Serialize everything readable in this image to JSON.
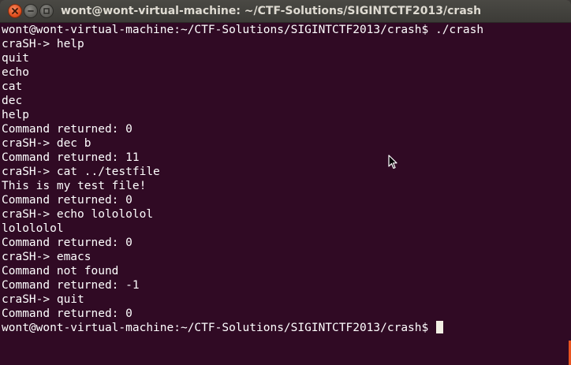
{
  "window": {
    "title": "wont@wont-virtual-machine: ~/CTF-Solutions/SIGINTCTF2013/crash",
    "buttons": {
      "close_icon": "close-icon",
      "minimize_icon": "minimize-icon",
      "maximize_icon": "maximize-icon"
    }
  },
  "terminal": {
    "lines": [
      "wont@wont-virtual-machine:~/CTF-Solutions/SIGINTCTF2013/crash$ ./crash",
      "craSH-> help",
      "quit",
      "echo",
      "cat",
      "dec",
      "help",
      "Command returned: 0",
      "craSH-> dec b",
      "Command returned: 11",
      "craSH-> cat ../testfile",
      "This is my test file!",
      "Command returned: 0",
      "craSH-> echo lolololol",
      "lolololol",
      "Command returned: 0",
      "craSH-> emacs",
      "Command not found",
      "Command returned: -1",
      "craSH-> quit",
      "Command returned: 0"
    ],
    "prompt": "wont@wont-virtual-machine:~/CTF-Solutions/SIGINTCTF2013/crash$ "
  },
  "colors": {
    "terminal_background": "#300a24",
    "terminal_text": "#ffffff",
    "titlebar": "#3c3b37",
    "close_button": "#e0501f",
    "cursor": "#f2efe4"
  }
}
